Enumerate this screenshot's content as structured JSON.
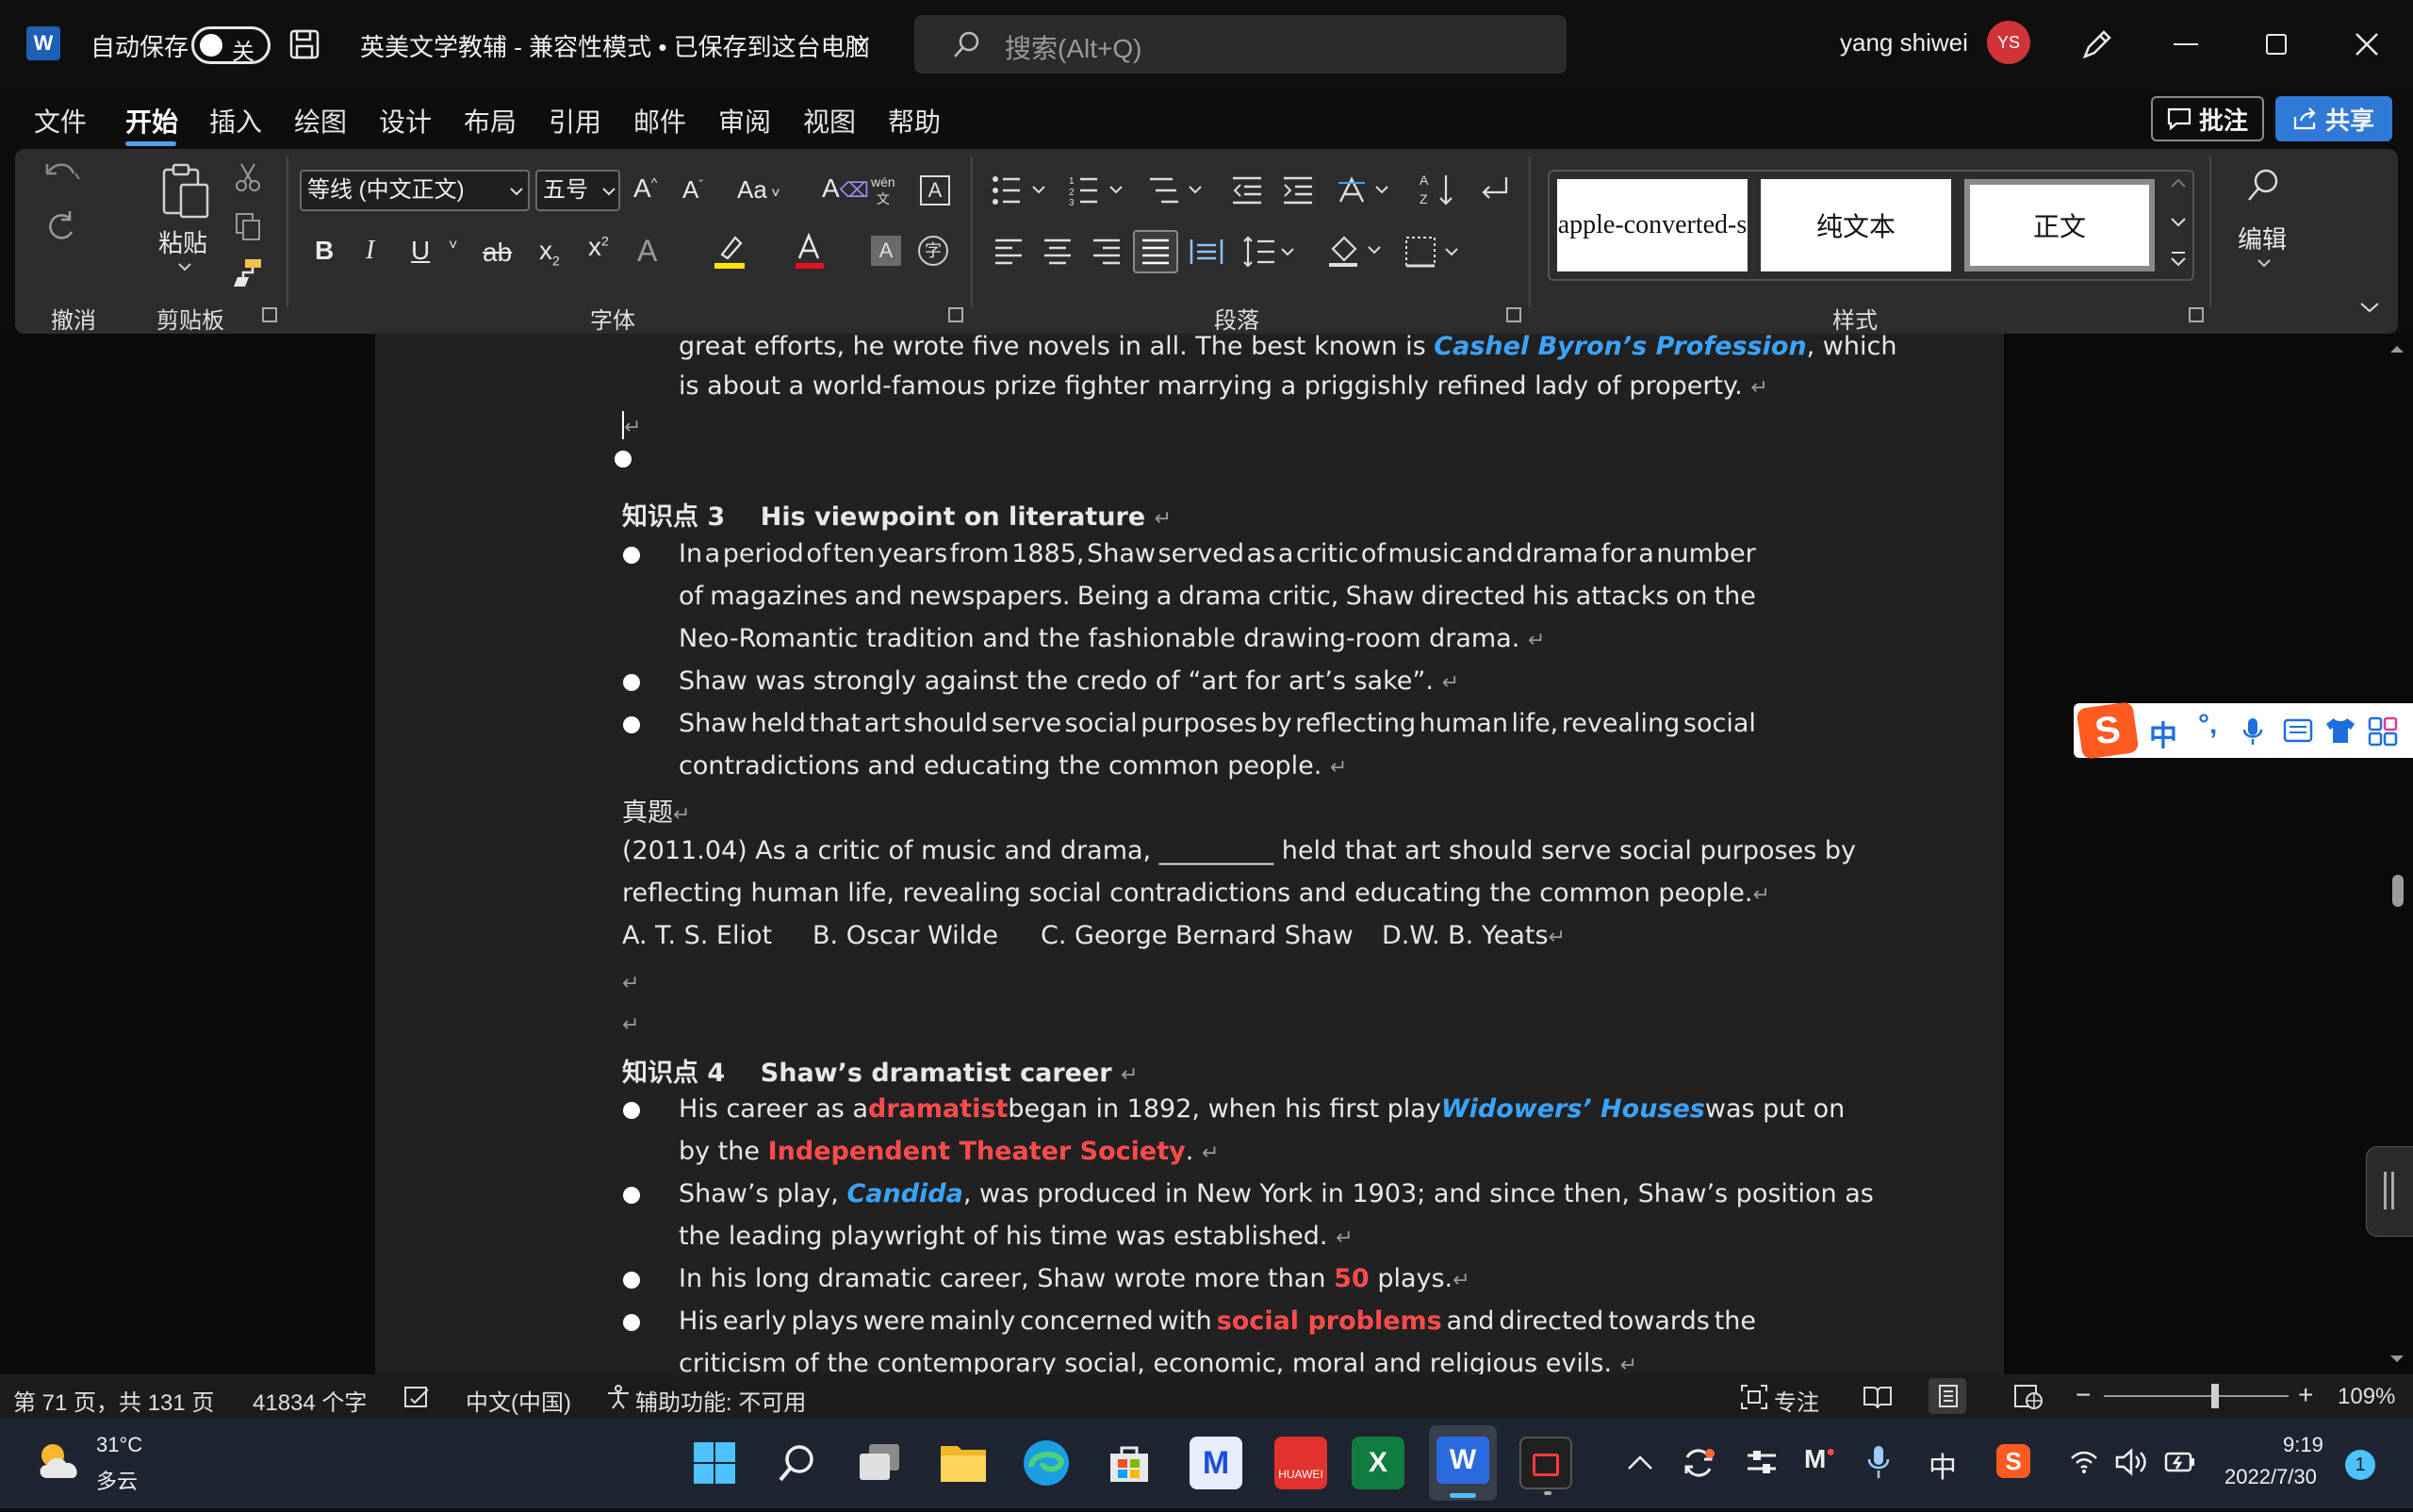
{
  "titlebar": {
    "autosave_label": "自动保存",
    "autosave_state": "关",
    "doc_title": "英美文学教辅 - 兼容性模式 • 已保存到这台电脑",
    "search_placeholder": "搜索(Alt+Q)",
    "user_name": "yang shiwei",
    "user_initials": "YS"
  },
  "menu": {
    "items": [
      "文件",
      "开始",
      "插入",
      "绘图",
      "设计",
      "布局",
      "引用",
      "邮件",
      "审阅",
      "视图",
      "帮助"
    ],
    "active": "开始",
    "comment_label": "批注",
    "share_label": "共享"
  },
  "ribbon": {
    "groups": {
      "undo": "撤消",
      "clipboard": "剪贴板",
      "font": "字体",
      "paragraph": "段落",
      "styles": "样式"
    },
    "paste_label": "粘贴",
    "font_name": "等线 (中文正文)",
    "font_size": "五号",
    "wen_label": "wén",
    "styles": [
      "apple-converted-s",
      "纯文本",
      "正文"
    ],
    "edit_label": "编辑"
  },
  "document": {
    "top_line1_a": "great efforts, he wrote five novels in all. The best known is",
    "top_line1_b": "Cashel Byron’s Profession",
    "top_line1_c": ", which",
    "top_line2": "is about a world-famous prize fighter marrying a priggishly refined lady of property.",
    "kp3_label": "知识点 3",
    "kp3_title": "His viewpoint on literature",
    "kp3_b1_l1": [
      "In",
      "a",
      "period",
      "of",
      "ten",
      "years",
      "from",
      "1885,",
      "Shaw",
      "served",
      "as",
      "a",
      "critic",
      "of",
      "music",
      "and",
      "drama",
      "for",
      "a",
      "number"
    ],
    "kp3_b1_l2": [
      "of",
      "magazines",
      "and",
      "newspapers.",
      "Being",
      "a",
      "drama",
      "critic,",
      "Shaw",
      "directed",
      "his",
      "attacks",
      "on",
      "the"
    ],
    "kp3_b1_l3": "Neo-Romantic tradition and the fashionable drawing-room drama.",
    "kp3_b2": "Shaw was strongly against the credo of “art for art’s sake”.",
    "kp3_b3_l1": [
      "Shaw",
      "held",
      "that",
      "art",
      "should",
      "serve",
      "social",
      "purposes",
      "by",
      "reflecting",
      "human",
      "life,",
      "revealing",
      "social"
    ],
    "kp3_b3_l2": "contradictions and educating the common people.",
    "exam_label": "真题",
    "exam_q_l1": "(2011.04) As a critic of music and drama, _________ held that art should serve social purposes by",
    "exam_q_l2": "reflecting human life, revealing social contradictions and educating the common people.",
    "opt_a": "A. T. S. Eliot",
    "opt_b": "B. Oscar Wilde",
    "opt_c": "C. George Bernard Shaw",
    "opt_d": "D.W. B. Yeats",
    "kp4_label": "知识点 4",
    "kp4_title": "Shaw’s dramatist career",
    "kp4_b1_l1_a": "His career as a",
    "kp4_b1_l1_b": "dramatist",
    "kp4_b1_l1_c": "began in 1892, when his first play",
    "kp4_b1_l1_d": "Widowers’ Houses",
    "kp4_b1_l1_e": "was put on",
    "kp4_b1_l2_a": "by the",
    "kp4_b1_l2_b": "Independent Theater Society",
    "kp4_b1_l2_c": ".",
    "kp4_b2_l1_a": "Shaw’s play,",
    "kp4_b2_l1_b": "Candida",
    "kp4_b2_l1_c": ", was produced in New York in 1903; and since then, Shaw’s position as",
    "kp4_b2_l2": "the leading playwright of his time was established.",
    "kp4_b3_a": "In his long dramatic career, Shaw wrote more than",
    "kp4_b3_b": "50",
    "kp4_b3_c": "plays.",
    "kp4_b4_l1_a": [
      "His",
      "early",
      "plays",
      "were",
      "mainly",
      "concerned",
      "with"
    ],
    "kp4_b4_l1_b": "social problems",
    "kp4_b4_l1_c": [
      "and",
      "directed",
      "towards",
      "the"
    ],
    "kp4_b4_l2": "criticism of the contemporary social, economic, moral and religious evils."
  },
  "ime": {
    "mode": "中"
  },
  "status": {
    "page": "第 71 页，共 131 页",
    "words": "41834 个字",
    "language": "中文(中国)",
    "accessibility": "辅助功能: 不可用",
    "focus": "专注",
    "zoom": "109%",
    "zoom_level_fraction": 0.6
  },
  "taskbar": {
    "temp": "31°C",
    "weather": "多云",
    "ime_indicator": "中",
    "time": "9:19",
    "date": "2022/7/30",
    "notifications": "1"
  },
  "colors": {
    "accent": "#2f7ad6",
    "red_highlight": "#ff4b4b",
    "blue_title": "#3ba4ff"
  }
}
